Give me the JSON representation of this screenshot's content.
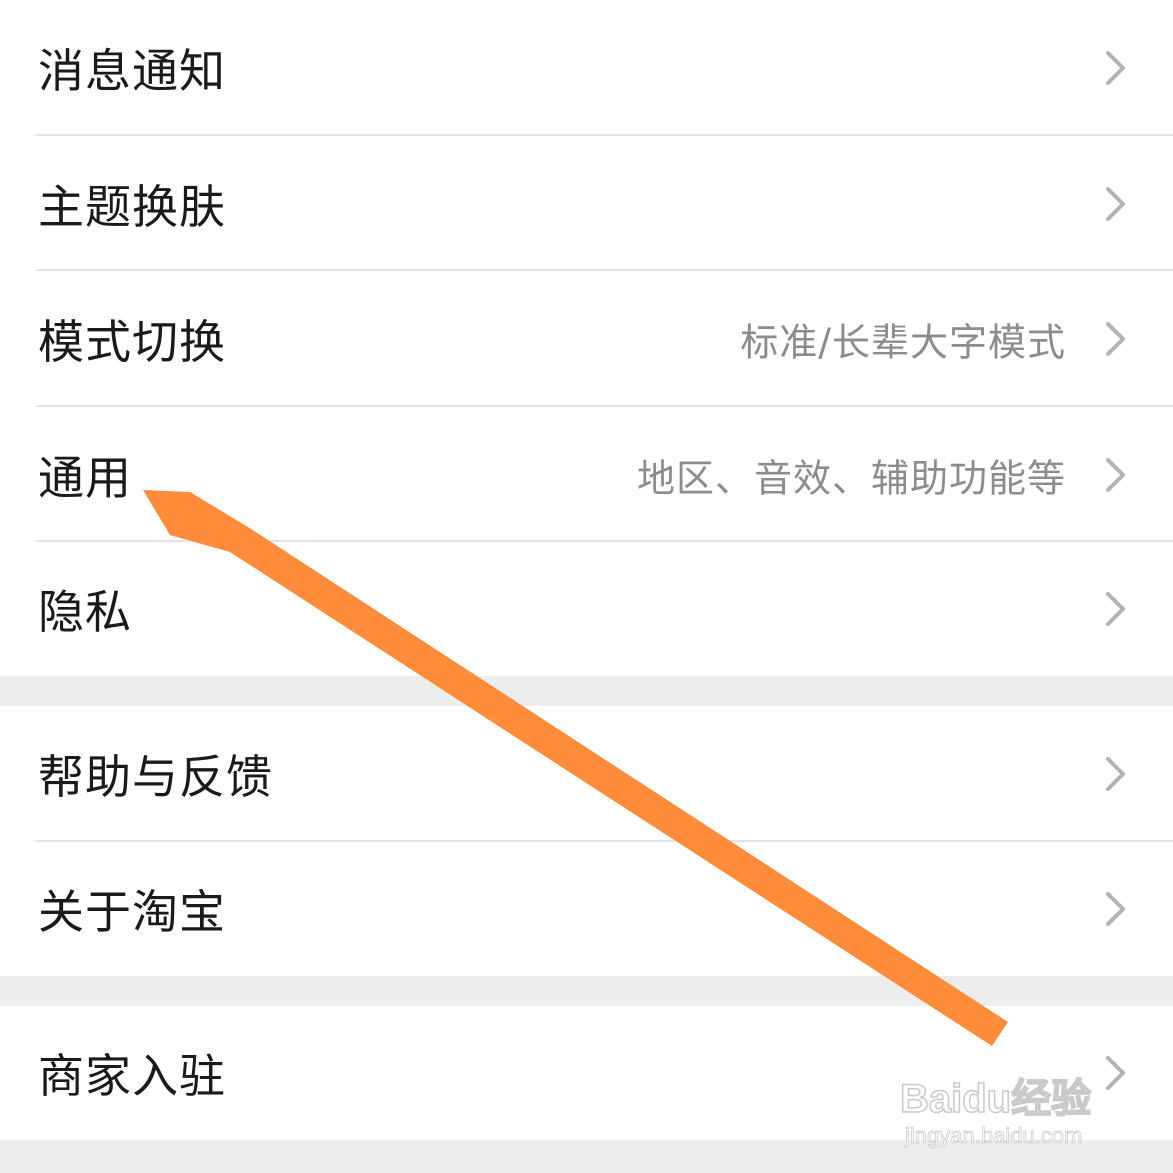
{
  "settings": {
    "items": [
      {
        "label": "消息通知",
        "subtitle": ""
      },
      {
        "label": "主题换肤",
        "subtitle": ""
      },
      {
        "label": "模式切换",
        "subtitle": "标准/长辈大字模式"
      },
      {
        "label": "通用",
        "subtitle": "地区、音效、辅助功能等"
      },
      {
        "label": "隐私",
        "subtitle": ""
      },
      {
        "label": "帮助与反馈",
        "subtitle": ""
      },
      {
        "label": "关于淘宝",
        "subtitle": ""
      },
      {
        "label": "商家入驻",
        "subtitle": ""
      }
    ]
  },
  "watermark": {
    "brand": "Baidu经验",
    "url": "jingyan.baidu.com"
  },
  "colors": {
    "background": "#ededed",
    "card": "#ffffff",
    "text": "#1a1a1a",
    "subtext": "#8c8c8c",
    "chevron": "#b3b3b3",
    "annotation_arrow": "#ff8c3a"
  }
}
